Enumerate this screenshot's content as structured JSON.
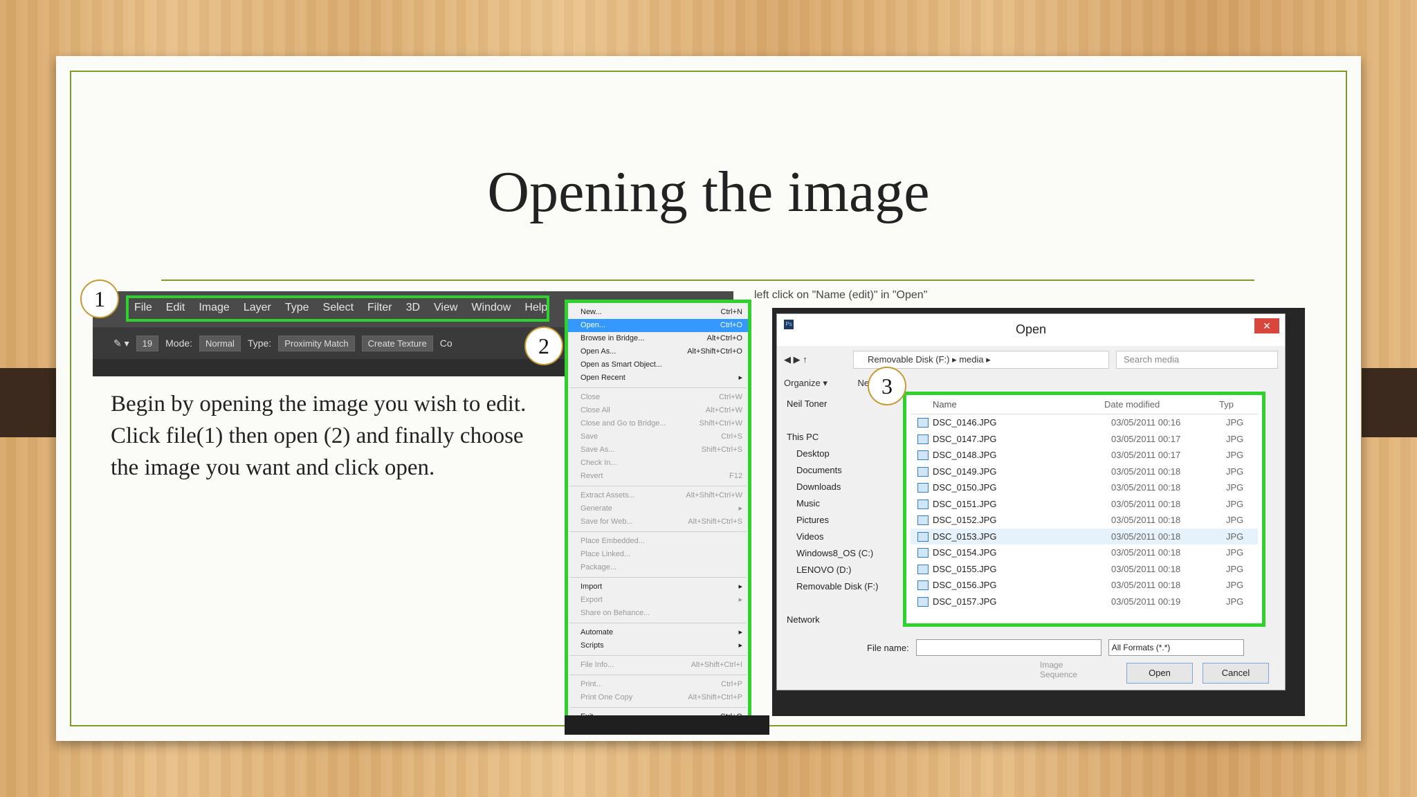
{
  "slide": {
    "title": "Opening the image",
    "body": "Begin by opening the image you wish to edit. Click file(1) then open (2) and finally choose the image you want and click open.",
    "badges": [
      "1",
      "2",
      "3"
    ],
    "caption": "left click on \"Name (edit)\" in \"Open\""
  },
  "photoshop": {
    "menu": [
      "File",
      "Edit",
      "Image",
      "Layer",
      "Type",
      "Select",
      "Filter",
      "3D",
      "View",
      "Window",
      "Help"
    ],
    "options": {
      "size": "19",
      "mode_label": "Mode:",
      "mode_value": "Normal",
      "type_label": "Type:",
      "type_a": "Proximity Match",
      "type_b": "Create Texture",
      "more": "Co"
    },
    "file_menu": [
      {
        "label": "New...",
        "shortcut": "Ctrl+N"
      },
      {
        "label": "Open...",
        "shortcut": "Ctrl+O",
        "state": "hl"
      },
      {
        "label": "Browse in Bridge...",
        "shortcut": "Alt+Ctrl+O"
      },
      {
        "label": "Open As...",
        "shortcut": "Alt+Shift+Ctrl+O"
      },
      {
        "label": "Open as Smart Object...",
        "shortcut": ""
      },
      {
        "label": "Open Recent",
        "shortcut": "▸"
      },
      {
        "sep": true
      },
      {
        "label": "Close",
        "shortcut": "Ctrl+W",
        "state": "dis"
      },
      {
        "label": "Close All",
        "shortcut": "Alt+Ctrl+W",
        "state": "dis"
      },
      {
        "label": "Close and Go to Bridge...",
        "shortcut": "Shift+Ctrl+W",
        "state": "dis"
      },
      {
        "label": "Save",
        "shortcut": "Ctrl+S",
        "state": "dis"
      },
      {
        "label": "Save As...",
        "shortcut": "Shift+Ctrl+S",
        "state": "dis"
      },
      {
        "label": "Check In...",
        "shortcut": "",
        "state": "dis"
      },
      {
        "label": "Revert",
        "shortcut": "F12",
        "state": "dis"
      },
      {
        "sep": true
      },
      {
        "label": "Extract Assets...",
        "shortcut": "Alt+Shift+Ctrl+W",
        "state": "dis"
      },
      {
        "label": "Generate",
        "shortcut": "▸",
        "state": "dis"
      },
      {
        "label": "Save for Web...",
        "shortcut": "Alt+Shift+Ctrl+S",
        "state": "dis"
      },
      {
        "sep": true
      },
      {
        "label": "Place Embedded...",
        "shortcut": "",
        "state": "dis"
      },
      {
        "label": "Place Linked...",
        "shortcut": "",
        "state": "dis"
      },
      {
        "label": "Package...",
        "shortcut": "",
        "state": "dis"
      },
      {
        "sep": true
      },
      {
        "label": "Import",
        "shortcut": "▸"
      },
      {
        "label": "Export",
        "shortcut": "▸",
        "state": "dis"
      },
      {
        "label": "Share on Behance...",
        "shortcut": "",
        "state": "dis"
      },
      {
        "sep": true
      },
      {
        "label": "Automate",
        "shortcut": "▸"
      },
      {
        "label": "Scripts",
        "shortcut": "▸"
      },
      {
        "sep": true
      },
      {
        "label": "File Info...",
        "shortcut": "Alt+Shift+Ctrl+I",
        "state": "dis"
      },
      {
        "sep": true
      },
      {
        "label": "Print...",
        "shortcut": "Ctrl+P",
        "state": "dis"
      },
      {
        "label": "Print One Copy",
        "shortcut": "Alt+Shift+Ctrl+P",
        "state": "dis"
      },
      {
        "sep": true
      },
      {
        "label": "Exit",
        "shortcut": "Ctrl+Q"
      }
    ]
  },
  "dialog": {
    "title": "Open",
    "close": "✕",
    "app_icon": "Ps",
    "path": "Removable Disk (F:)  ▸  media  ▸",
    "search_placeholder": "Search media",
    "organize": "Organize ▾",
    "new_folder": "New folder",
    "nav": [
      "Neil Toner",
      "",
      "This PC",
      "Desktop",
      "Documents",
      "Downloads",
      "Music",
      "Pictures",
      "Videos",
      "Windows8_OS (C:)",
      "LENOVO (D:)",
      "Removable Disk (F:)",
      "",
      "Network"
    ],
    "columns": [
      "Name",
      "Date modified",
      "Typ"
    ],
    "files": [
      {
        "name": "DSC_0146.JPG",
        "date": "03/05/2011 00:16",
        "type": "JPG"
      },
      {
        "name": "DSC_0147.JPG",
        "date": "03/05/2011 00:17",
        "type": "JPG"
      },
      {
        "name": "DSC_0148.JPG",
        "date": "03/05/2011 00:17",
        "type": "JPG"
      },
      {
        "name": "DSC_0149.JPG",
        "date": "03/05/2011 00:18",
        "type": "JPG"
      },
      {
        "name": "DSC_0150.JPG",
        "date": "03/05/2011 00:18",
        "type": "JPG"
      },
      {
        "name": "DSC_0151.JPG",
        "date": "03/05/2011 00:18",
        "type": "JPG"
      },
      {
        "name": "DSC_0152.JPG",
        "date": "03/05/2011 00:18",
        "type": "JPG"
      },
      {
        "name": "DSC_0153.JPG",
        "date": "03/05/2011 00:18",
        "type": "JPG",
        "selected": true
      },
      {
        "name": "DSC_0154.JPG",
        "date": "03/05/2011 00:18",
        "type": "JPG"
      },
      {
        "name": "DSC_0155.JPG",
        "date": "03/05/2011 00:18",
        "type": "JPG"
      },
      {
        "name": "DSC_0156.JPG",
        "date": "03/05/2011 00:18",
        "type": "JPG"
      },
      {
        "name": "DSC_0157.JPG",
        "date": "03/05/2011 00:19",
        "type": "JPG"
      }
    ],
    "file_name_label": "File name:",
    "format": "All Formats (*.*)",
    "image_sequence": "Image Sequence",
    "open_btn": "Open",
    "cancel_btn": "Cancel"
  }
}
